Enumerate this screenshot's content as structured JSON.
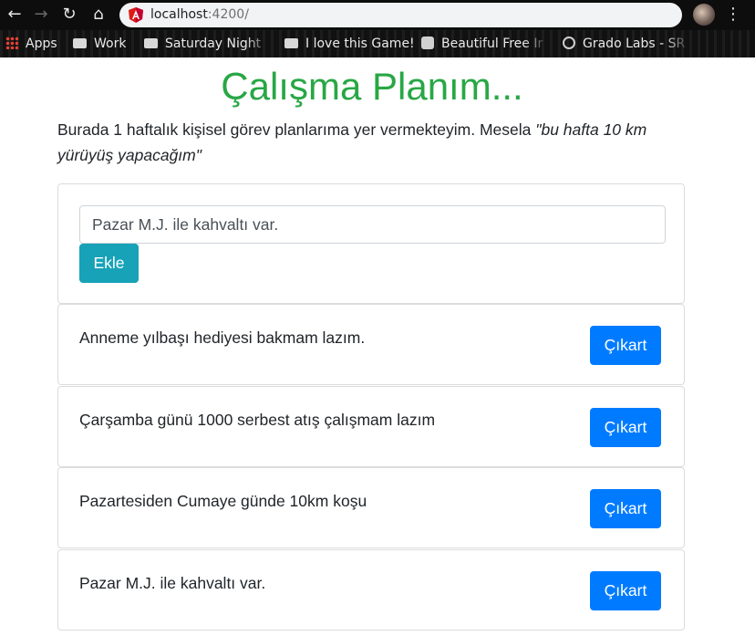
{
  "browser": {
    "url_host": "localhost",
    "url_port": ":4200/",
    "bookmarks": [
      {
        "label": "Apps",
        "icon": "apps-grid-icon"
      },
      {
        "label": "Work",
        "icon": "folder-icon"
      },
      {
        "label": "Saturday Night",
        "icon": "folder-icon"
      },
      {
        "label": "I love this Game!",
        "icon": "folder-icon"
      },
      {
        "label": "Beautiful Free Ir",
        "icon": "camera-icon"
      },
      {
        "label": "Grado Labs - SR",
        "icon": "globe-icon"
      }
    ]
  },
  "page": {
    "title": "Çalışma Planım...",
    "intro_text": "Burada 1 haftalık kişisel görev planlarıma yer vermekteyim. Mesela ",
    "intro_example": "\"bu hafta 10 km yürüyüş yapacağım\""
  },
  "form": {
    "input_value": "Pazar M.J. ile kahvaltı var.",
    "add_label": "Ekle"
  },
  "tasks": [
    {
      "text": "Anneme yılbaşı hediyesi bakmam lazım.",
      "remove_label": "Çıkart"
    },
    {
      "text": "Çarşamba günü 1000 serbest atış çalışmam lazım",
      "remove_label": "Çıkart"
    },
    {
      "text": "Pazartesiden Cumaye günde 10km koşu",
      "remove_label": "Çıkart"
    },
    {
      "text": "Pazar M.J. ile kahvaltı var.",
      "remove_label": "Çıkart"
    }
  ],
  "colors": {
    "title": "#28a745",
    "add_button": "#17a2b8",
    "remove_button": "#007bff"
  }
}
